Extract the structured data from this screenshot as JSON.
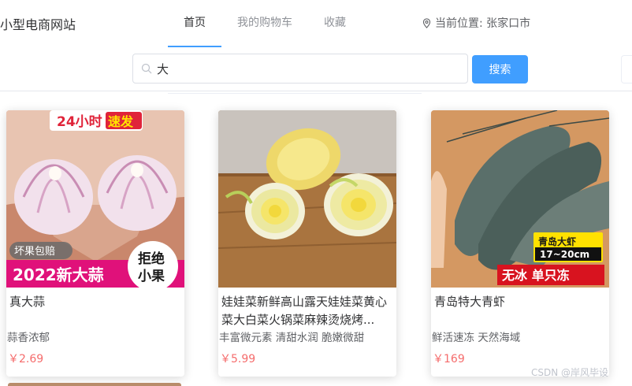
{
  "header": {
    "logo": "小型电商网站",
    "nav": [
      "首页",
      "我的购物车",
      "收藏"
    ],
    "location_label": "当前位置: 张家口市"
  },
  "search": {
    "value": "大",
    "button": "搜索"
  },
  "products": [
    {
      "name": "真大蒜",
      "desc": "蒜香浓郁",
      "price": "￥2.69",
      "image_text": {
        "top": "24小时",
        "top_highlight": "速发",
        "tag": "坏果包赔",
        "banner": "2022新大蒜",
        "badge_line1": "拒绝",
        "badge_line2": "小果"
      }
    },
    {
      "name": "娃娃菜新鲜高山露天娃娃菜黄心菜大白菜火锅菜麻辣烫烧烤...",
      "desc": "丰富微元素 清甜水润 脆嫩微甜",
      "price": "￥5.99"
    },
    {
      "name": "青岛特大青虾",
      "desc": "鲜活速冻 天然海域",
      "price": "￥169",
      "image_text": {
        "label_title": "青岛大虾",
        "label_size": "17~20cm",
        "banner": "无冰 单只冻"
      }
    }
  ],
  "watermark": "CSDN @岸风毕设",
  "colors": {
    "accent": "#409eff",
    "price": "#f56c6c"
  }
}
